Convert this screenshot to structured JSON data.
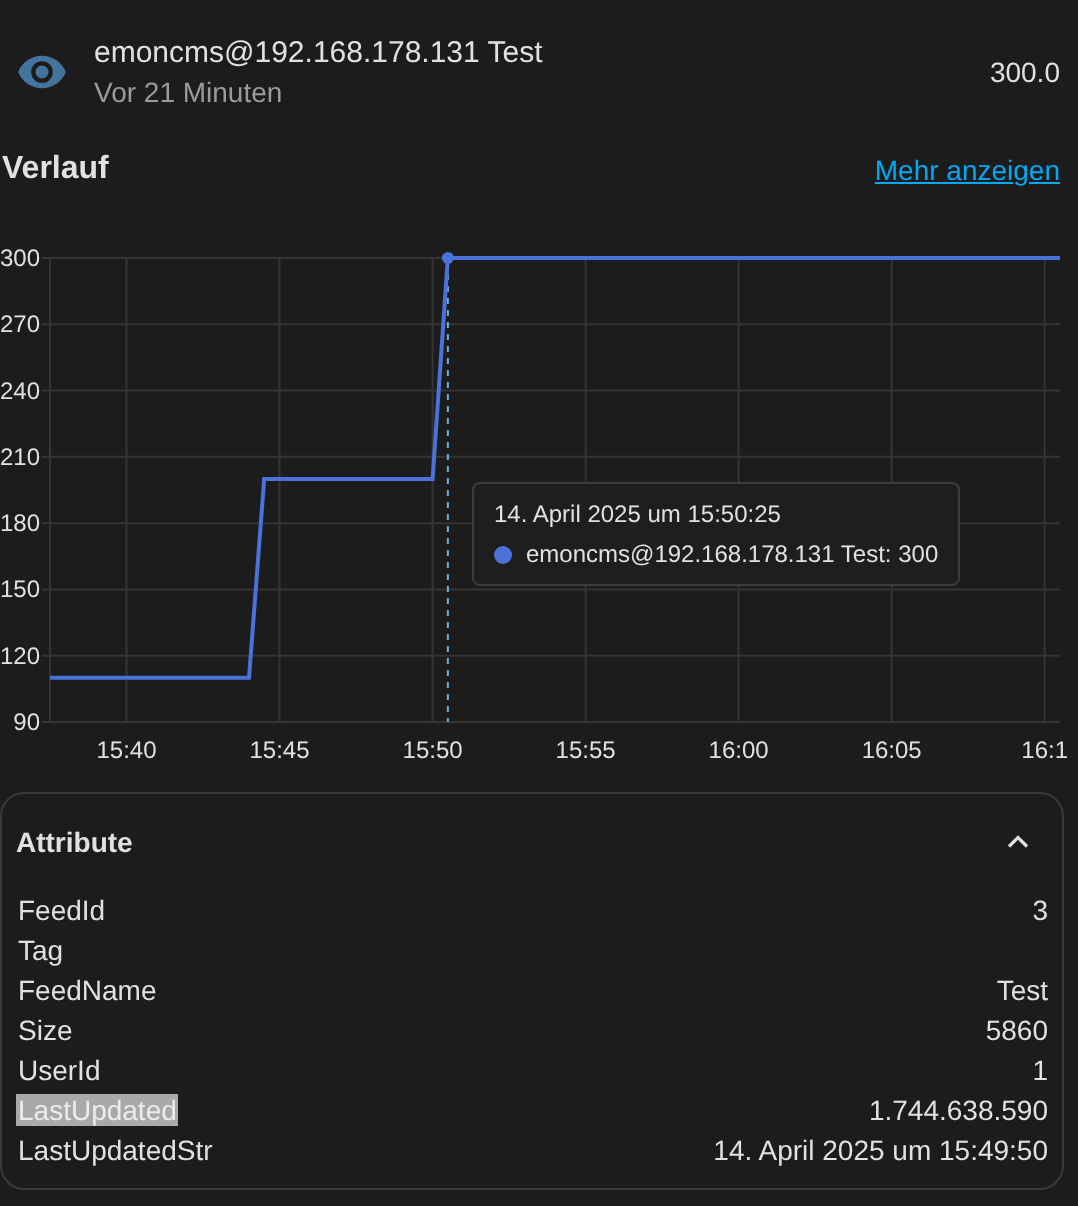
{
  "entity": {
    "name": "emoncms@192.168.178.131 Test",
    "last_changed": "Vor 21 Minuten",
    "state": "300.0"
  },
  "history": {
    "title": "Verlauf",
    "more_link": "Mehr anzeigen",
    "chart_data": {
      "type": "line",
      "categories": [
        null,
        null,
        null,
        null,
        null,
        "15:40",
        null,
        null,
        null,
        null,
        null,
        null,
        null,
        null,
        null,
        "15:45",
        null,
        null,
        null,
        null,
        null,
        null,
        null,
        null,
        null,
        "15:50",
        null,
        null,
        null,
        null,
        null,
        null,
        null,
        null,
        null,
        "15:55",
        null,
        null,
        null,
        null,
        null,
        null,
        null,
        null,
        null,
        "16:00",
        null,
        null,
        null,
        null,
        null,
        null,
        null,
        null,
        null,
        "16:05",
        null,
        null,
        null,
        null,
        null,
        null,
        null,
        null,
        null,
        "16:1",
        null
      ],
      "series": [
        {
          "name": "emoncms@192.168.178.131 Test",
          "color": "#4a72d9",
          "values": [
            110,
            110,
            110,
            110,
            110,
            110,
            110,
            110,
            110,
            110,
            110,
            110,
            110,
            110,
            200,
            200,
            200,
            200,
            200,
            200,
            200,
            200,
            200,
            200,
            200,
            200,
            300,
            300,
            300,
            300,
            300,
            300,
            300,
            300,
            300,
            300,
            300,
            300,
            300,
            300,
            300,
            300,
            300,
            300,
            300,
            300,
            300,
            300,
            300,
            300,
            300,
            300,
            300,
            300,
            300,
            300,
            300,
            300,
            300,
            300,
            300,
            300,
            300,
            300,
            300,
            300,
            300
          ]
        }
      ],
      "ylim": [
        90,
        300
      ],
      "grid": true,
      "yticks": [
        90,
        120,
        150,
        180,
        210,
        240,
        270,
        300
      ]
    },
    "tooltip": {
      "title": "14. April 2025 um 15:50:25",
      "value": ": 300"
    }
  },
  "attributes": {
    "title": "Attribute",
    "expanded": true,
    "rows": [
      {
        "name": "FeedId",
        "value": "3",
        "highlighted": false
      },
      {
        "name": "Tag",
        "highlighted": false
      },
      {
        "name": "FeedName",
        "value": "Test",
        "highlighted": false
      },
      {
        "name": "Size",
        "value": "5860",
        "highlighted": false
      },
      {
        "name": "UserId",
        "value": "1",
        "highlighted": false
      },
      {
        "name": "LastUpdated",
        "value": "1.744.638.590",
        "highlighted": true
      },
      {
        "name": "LastUpdatedStr",
        "value": "14. April 2025 um 15:49:50",
        "highlighted": false
      }
    ]
  }
}
